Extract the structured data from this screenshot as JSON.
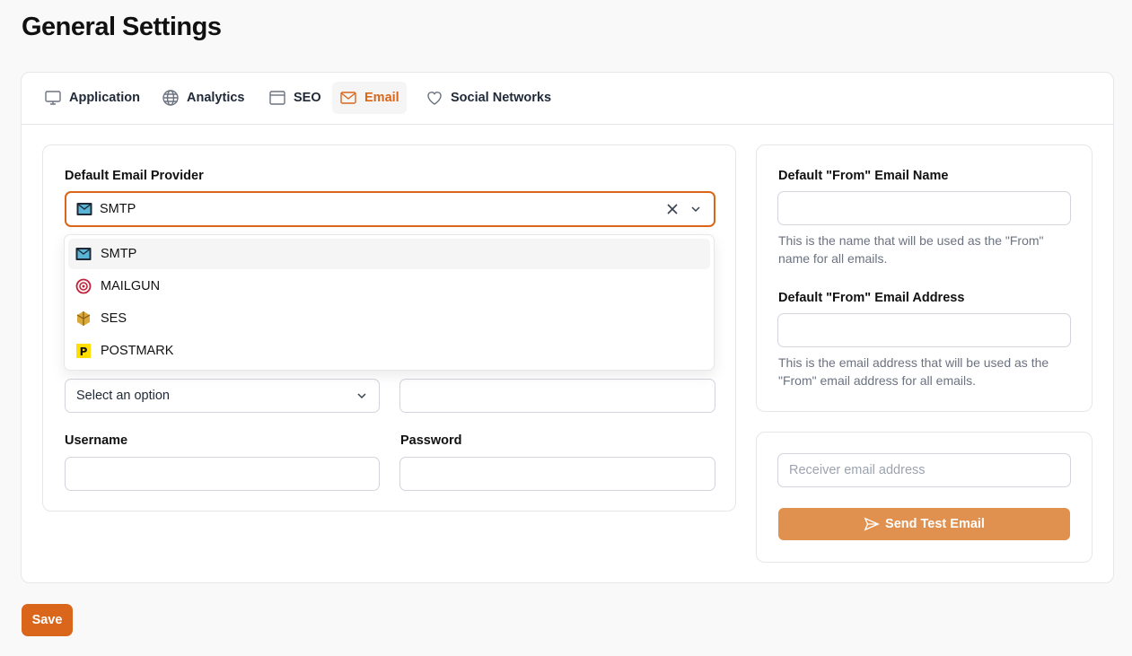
{
  "page": {
    "title": "General Settings"
  },
  "tabs": [
    {
      "label": "Application",
      "icon": "monitor-icon"
    },
    {
      "label": "Analytics",
      "icon": "globe-icon"
    },
    {
      "label": "SEO",
      "icon": "browser-window-icon"
    },
    {
      "label": "Email",
      "icon": "envelope-icon",
      "active": true
    },
    {
      "label": "Social Networks",
      "icon": "heart-icon"
    }
  ],
  "email_provider": {
    "label": "Default Email Provider",
    "selected": "SMTP",
    "options": [
      {
        "label": "SMTP",
        "icon": "smtp-envelope-icon"
      },
      {
        "label": "MAILGUN",
        "icon": "mailgun-icon"
      },
      {
        "label": "SES",
        "icon": "ses-icon"
      },
      {
        "label": "POSTMARK",
        "icon": "postmark-icon"
      }
    ]
  },
  "smtp": {
    "encryption_placeholder": "Select an option",
    "username_label": "Username",
    "password_label": "Password"
  },
  "from": {
    "name_label": "Default \"From\" Email Name",
    "name_help": "This is the name that will be used as the \"From\" name for all emails.",
    "address_label": "Default \"From\" Email Address",
    "address_help": "This is the email address that will be used as the \"From\" email address for all emails."
  },
  "test_email": {
    "placeholder": "Receiver email address",
    "button_label": "Send Test Email"
  },
  "footer": {
    "save_label": "Save"
  },
  "colors": {
    "accent": "#d9661b",
    "accent_light": "#e0904f"
  }
}
